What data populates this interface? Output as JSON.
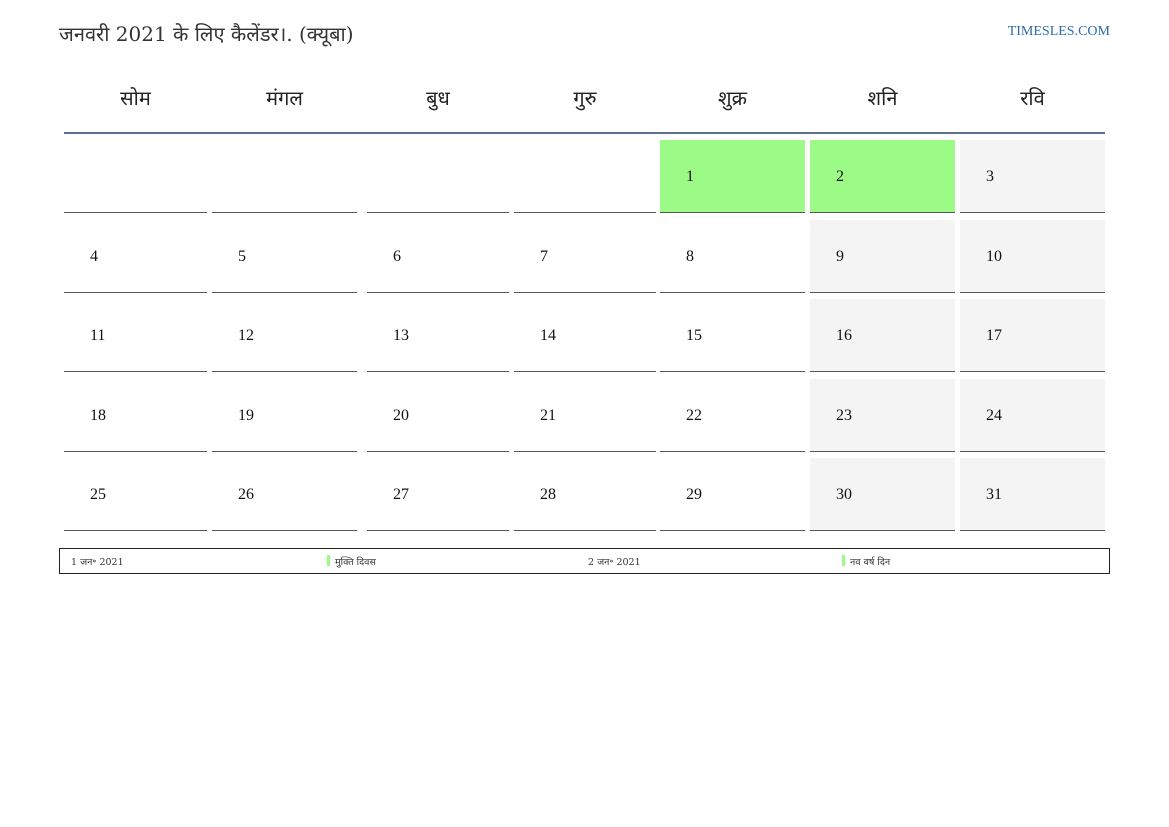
{
  "header": {
    "title": "जनवरी 2021 के लिए कैलेंडर।. (क्यूबा)",
    "site": "TIMESLES.COM"
  },
  "calendar": {
    "weekdays": [
      "सोम",
      "मंगल",
      "बुध",
      "गुरु",
      "शुक्र",
      "शनि",
      "रवि"
    ],
    "weeks": [
      [
        "",
        "",
        "",
        "",
        "1",
        "2",
        "3"
      ],
      [
        "4",
        "5",
        "6",
        "7",
        "8",
        "9",
        "10"
      ],
      [
        "11",
        "12",
        "13",
        "14",
        "15",
        "16",
        "17"
      ],
      [
        "18",
        "19",
        "20",
        "21",
        "22",
        "23",
        "24"
      ],
      [
        "25",
        "26",
        "27",
        "28",
        "29",
        "30",
        "31"
      ]
    ],
    "holidays": [
      "1",
      "2"
    ],
    "colors": {
      "holiday": "#9cfa87",
      "weekend": "#f4f4f4",
      "header_rule": "#5a7290",
      "link": "#2a6aa8"
    }
  },
  "legend": {
    "items": [
      {
        "date": "1 जन॰ 2021",
        "name": "मुक्ति दिवस"
      },
      {
        "date": "2 जन॰ 2021",
        "name": "नव वर्ष दिन"
      }
    ]
  }
}
